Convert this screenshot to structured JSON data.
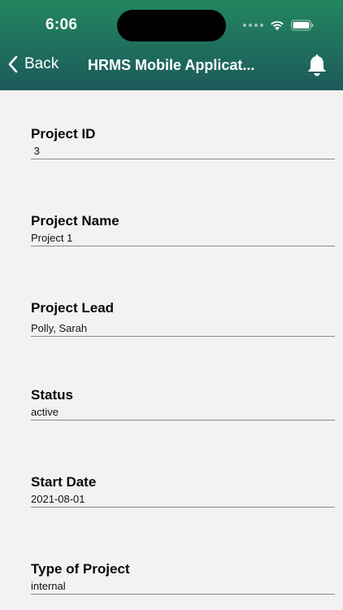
{
  "status_bar": {
    "time": "6:06"
  },
  "nav": {
    "back_label": "Back",
    "title": "HRMS Mobile Applicat..."
  },
  "fields": [
    {
      "label": "Project ID",
      "value": " 3"
    },
    {
      "label": "Project Name",
      "value": "Project 1"
    },
    {
      "label": "Project Lead",
      "value": "Polly, Sarah"
    },
    {
      "label": "Status",
      "value": "active"
    },
    {
      "label": "Start Date",
      "value": "2021-08-01"
    },
    {
      "label": "Type of Project",
      "value": "internal"
    }
  ],
  "colors": {
    "header_top": "#23865f",
    "header_bottom": "#1d5a5b",
    "background": "#f2f2f2"
  }
}
